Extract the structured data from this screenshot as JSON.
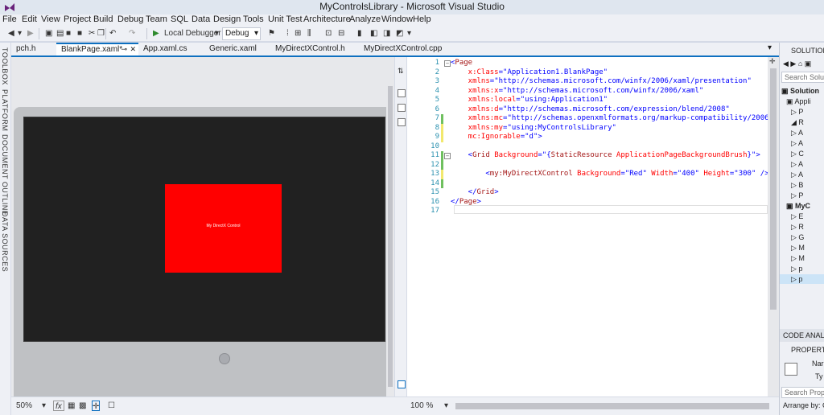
{
  "window": {
    "title": "MyControlsLibrary - Microsoft Visual Studio"
  },
  "menu": [
    "File",
    "Edit",
    "View",
    "Project",
    "Build",
    "Debug",
    "Team",
    "SQL",
    "Data",
    "Design",
    "Tools",
    "Unit Test",
    "Architecture",
    "Analyze",
    "Window",
    "Help"
  ],
  "toolbar": {
    "debug_target": "Local Debugger",
    "config": "Debug"
  },
  "left_tabs": [
    "TOOLBOX",
    "PLATFORM",
    "DOCUMENT OUTLINE",
    "DATA SOURCES"
  ],
  "doc_tabs": [
    {
      "label": "pch.h",
      "active": false
    },
    {
      "label": "BlankPage.xaml*",
      "active": true
    },
    {
      "label": "App.xaml.cs",
      "active": false
    },
    {
      "label": "Generic.xaml",
      "active": false
    },
    {
      "label": "MyDirectXControl.h",
      "active": false
    },
    {
      "label": "MyDirectXControl.cpp",
      "active": false
    }
  ],
  "designer": {
    "control_label": "My DirectX Control",
    "control_color": "#ff0000",
    "background": "#212121",
    "zoom": "50%",
    "fx_label": "fx"
  },
  "code": {
    "zoom": "100 %",
    "lines": [
      {
        "n": "1",
        "parts": [
          [
            "c-punc",
            "<"
          ],
          [
            "c-tag",
            "Page"
          ]
        ]
      },
      {
        "n": "2",
        "parts": [
          [
            "c-attr",
            "    x:Class"
          ],
          [
            "c-punc",
            "=\""
          ],
          [
            "c-val",
            "Application1.BlankPage"
          ],
          [
            "c-punc",
            "\""
          ]
        ]
      },
      {
        "n": "3",
        "parts": [
          [
            "c-attr",
            "    xmlns"
          ],
          [
            "c-punc",
            "=\""
          ],
          [
            "c-val",
            "http://schemas.microsoft.com/winfx/2006/xaml/presentation"
          ],
          [
            "c-punc",
            "\""
          ]
        ]
      },
      {
        "n": "4",
        "parts": [
          [
            "c-attr",
            "    xmlns:x"
          ],
          [
            "c-punc",
            "=\""
          ],
          [
            "c-val",
            "http://schemas.microsoft.com/winfx/2006/xaml"
          ],
          [
            "c-punc",
            "\""
          ]
        ]
      },
      {
        "n": "5",
        "parts": [
          [
            "c-attr",
            "    xmlns:local"
          ],
          [
            "c-punc",
            "=\""
          ],
          [
            "c-val",
            "using:Application1"
          ],
          [
            "c-punc",
            "\""
          ]
        ]
      },
      {
        "n": "6",
        "parts": [
          [
            "c-attr",
            "    xmlns:d"
          ],
          [
            "c-punc",
            "=\""
          ],
          [
            "c-val",
            "http://schemas.microsoft.com/expression/blend/2008"
          ],
          [
            "c-punc",
            "\""
          ]
        ]
      },
      {
        "n": "7",
        "parts": [
          [
            "c-attr",
            "    xmlns:mc"
          ],
          [
            "c-punc",
            "=\""
          ],
          [
            "c-val",
            "http://schemas.openxmlformats.org/markup-compatibility/2006"
          ],
          [
            "c-punc",
            "\""
          ]
        ]
      },
      {
        "n": "8",
        "parts": [
          [
            "c-attr",
            "    xmlns:my"
          ],
          [
            "c-punc",
            "=\""
          ],
          [
            "c-val",
            "using:MyControlsLibrary"
          ],
          [
            "c-punc",
            "\""
          ]
        ]
      },
      {
        "n": "9",
        "parts": [
          [
            "c-attr",
            "    mc:Ignorable"
          ],
          [
            "c-punc",
            "=\""
          ],
          [
            "c-val",
            "d"
          ],
          [
            "c-punc",
            "\">"
          ]
        ]
      },
      {
        "n": "10",
        "parts": []
      },
      {
        "n": "11",
        "parts": [
          [
            "c-punc",
            "    <"
          ],
          [
            "c-tag",
            "Grid"
          ],
          [
            "c-attr",
            " Background"
          ],
          [
            "c-punc",
            "=\"{"
          ],
          [
            "c-res",
            "StaticResource"
          ],
          [
            "c-attr",
            " ApplicationPageBackgroundBrush"
          ],
          [
            "c-punc",
            "}\">"
          ]
        ]
      },
      {
        "n": "12",
        "parts": []
      },
      {
        "n": "13",
        "parts": [
          [
            "c-punc",
            "        <"
          ],
          [
            "c-tag",
            "my:MyDirectXControl"
          ],
          [
            "c-attr",
            " Background"
          ],
          [
            "c-punc",
            "=\""
          ],
          [
            "c-val",
            "Red"
          ],
          [
            "c-punc",
            "\""
          ],
          [
            "c-attr",
            " Width"
          ],
          [
            "c-punc",
            "=\""
          ],
          [
            "c-val",
            "400"
          ],
          [
            "c-punc",
            "\""
          ],
          [
            "c-attr",
            " Height"
          ],
          [
            "c-punc",
            "=\""
          ],
          [
            "c-val",
            "300"
          ],
          [
            "c-punc",
            "\" />"
          ]
        ]
      },
      {
        "n": "14",
        "parts": []
      },
      {
        "n": "15",
        "parts": [
          [
            "c-punc",
            "    </"
          ],
          [
            "c-tag",
            "Grid"
          ],
          [
            "c-punc",
            ">"
          ]
        ]
      },
      {
        "n": "16",
        "parts": [
          [
            "c-punc",
            "</"
          ],
          [
            "c-tag",
            "Page"
          ],
          [
            "c-punc",
            ">"
          ]
        ]
      },
      {
        "n": "17",
        "parts": []
      }
    ]
  },
  "solution_panel": {
    "header": "SOLUTION",
    "search": "Search Solution",
    "items": [
      "Solution",
      "Appli",
      "P",
      "R",
      "A",
      "A",
      "C",
      "A",
      "A",
      "B",
      "P",
      "MyC",
      "E",
      "R",
      "G",
      "M",
      "M",
      "p",
      "p"
    ]
  },
  "code_analysis": {
    "header": "CODE ANALY"
  },
  "properties": {
    "header": "PROPERTIE",
    "name_label": "Nar",
    "type_label": "Ty",
    "search": "Search Prope",
    "arrange": "Arrange by: C"
  },
  "colors": {
    "accent": "#0e70c0",
    "changed": "#6fc05f",
    "unsaved": "#f2e86d"
  }
}
